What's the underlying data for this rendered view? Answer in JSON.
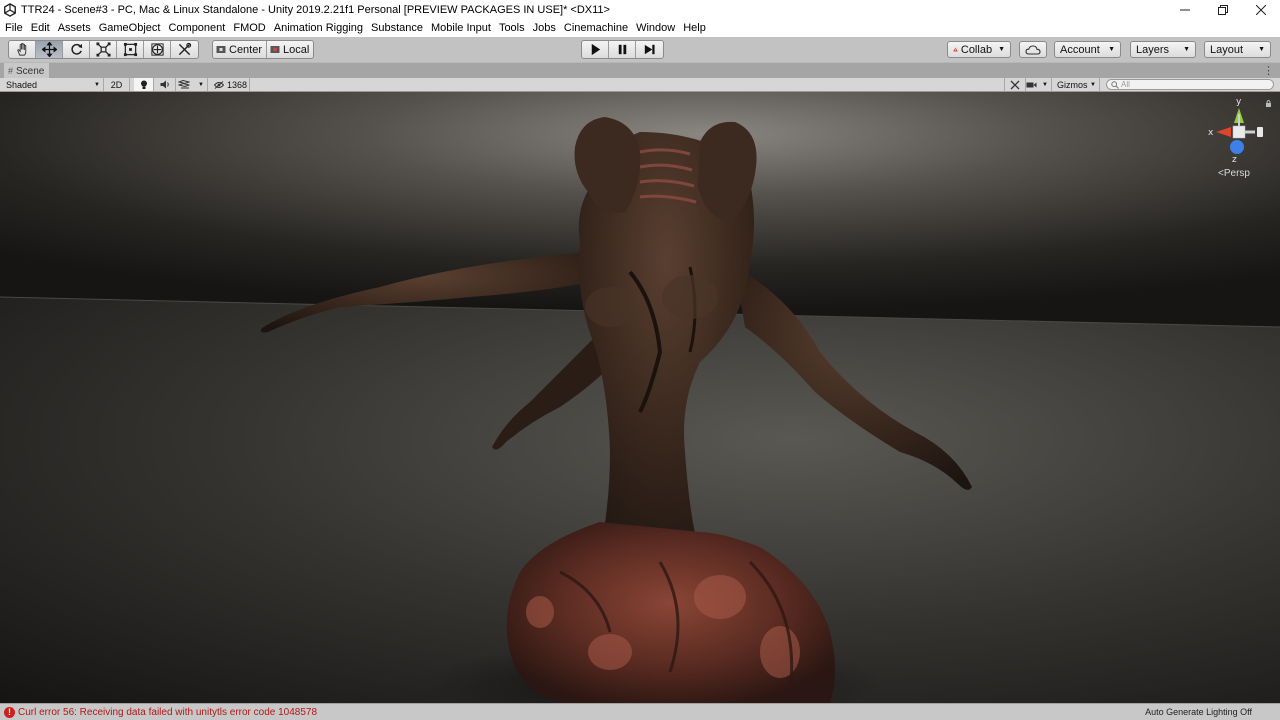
{
  "window": {
    "title": "TTR24 - Scene#3 - PC, Mac & Linux Standalone - Unity 2019.2.21f1 Personal [PREVIEW PACKAGES IN USE]* <DX11>",
    "controls": [
      "minimize-icon",
      "restore-icon",
      "close-icon"
    ]
  },
  "menu": [
    "File",
    "Edit",
    "Assets",
    "GameObject",
    "Component",
    "FMOD",
    "Animation Rigging",
    "Substance",
    "Mobile Input",
    "Tools",
    "Jobs",
    "Cinemachine",
    "Window",
    "Help"
  ],
  "toolbar": {
    "transform_tools": [
      {
        "name": "hand-tool",
        "icon": "hand-icon",
        "active": false
      },
      {
        "name": "move-tool",
        "icon": "move-icon",
        "active": true
      },
      {
        "name": "rotate-tool",
        "icon": "rotate-icon",
        "active": false
      },
      {
        "name": "scale-tool",
        "icon": "scale-icon",
        "active": false
      },
      {
        "name": "rect-tool",
        "icon": "rect-icon",
        "active": false
      },
      {
        "name": "transform-tool",
        "icon": "transform-icon",
        "active": false
      },
      {
        "name": "custom-tool",
        "icon": "custom-tool-icon",
        "active": false
      }
    ],
    "pivot_center_label": "Center",
    "pivot_local_label": "Local",
    "playback": [
      "play-icon",
      "pause-icon",
      "step-icon"
    ],
    "collab_label": "Collab",
    "account_label": "Account",
    "layers_label": "Layers",
    "layout_label": "Layout"
  },
  "scene_tab": {
    "label": "Scene"
  },
  "scene_toolbar": {
    "draw_mode": "Shaded",
    "mode_2d": "2D",
    "hidden_count": "1368",
    "gizmos_label": "Gizmos",
    "search_placeholder": "All"
  },
  "viewport": {
    "persp_label": "Persp",
    "axis_labels": {
      "x": "x",
      "y": "y",
      "z": "z"
    },
    "colors": {
      "x_axis": "#e0452a",
      "y_axis": "#8fcf3c",
      "z_axis": "#3f7fe8"
    }
  },
  "status": {
    "message": "Curl error 56: Receiving data failed with unitytls error code 1048578",
    "right": "Auto Generate Lighting Off",
    "error_color": "#b01818"
  }
}
